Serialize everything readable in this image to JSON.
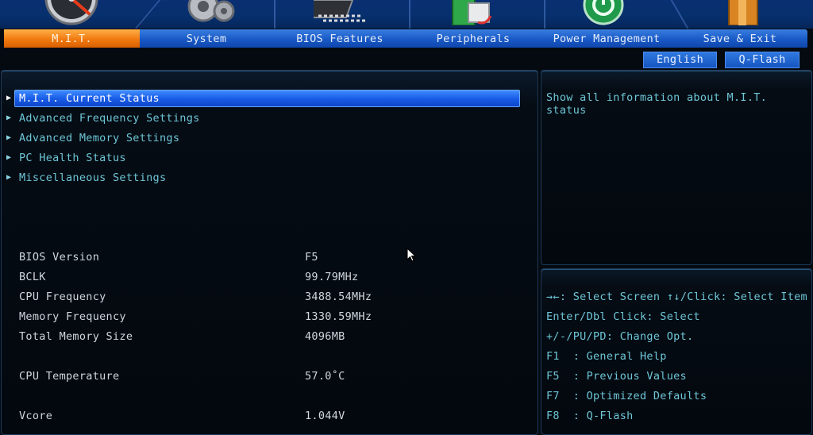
{
  "tabs": [
    {
      "label": "M.I.T.",
      "active": true
    },
    {
      "label": "System"
    },
    {
      "label": "BIOS Features"
    },
    {
      "label": "Peripherals"
    },
    {
      "label": "Power Management"
    },
    {
      "label": "Save & Exit"
    }
  ],
  "top_buttons": {
    "language": "English",
    "qflash": "Q-Flash"
  },
  "menu": [
    {
      "label": "M.I.T. Current Status",
      "selected": true
    },
    {
      "label": "Advanced Frequency Settings"
    },
    {
      "label": "Advanced Memory Settings"
    },
    {
      "label": "PC Health Status"
    },
    {
      "label": "Miscellaneous Settings"
    }
  ],
  "info": [
    {
      "label": "BIOS Version",
      "value": "F5"
    },
    {
      "label": "BCLK",
      "value": "99.79MHz"
    },
    {
      "label": "CPU Frequency",
      "value": "3488.54MHz"
    },
    {
      "label": "Memory Frequency",
      "value": "1330.59MHz"
    },
    {
      "label": "Total Memory Size",
      "value": "4096MB"
    },
    {
      "label": "CPU Temperature",
      "value": "57.0˚C"
    },
    {
      "label": "Vcore",
      "value": "1.044V"
    }
  ],
  "help_text": "Show all information about M.I.T. status",
  "key_help": [
    "→←: Select Screen",
    "↑↓/Click: Select Item",
    "Enter/Dbl Click: Select",
    "+/-/PU/PD: Change Opt.",
    "F1  : General Help",
    "F5  : Previous Values",
    "F7  : Optimized Defaults",
    "F8  : Q-Flash"
  ],
  "colors": {
    "accent_tab": "#f07a10",
    "tab_bar": "#1b5cc8",
    "menu_text": "#6ec6d6",
    "highlight": "#1a5de8"
  },
  "icons": [
    "speedometer-icon",
    "gear-icon",
    "chip-icon",
    "peripheral-card-icon",
    "power-icon",
    "exit-door-icon"
  ]
}
